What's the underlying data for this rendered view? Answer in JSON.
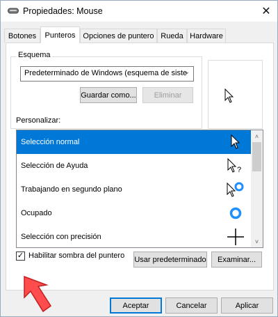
{
  "window": {
    "title": "Propiedades: Mouse",
    "close_label": "✕"
  },
  "tabs": [
    {
      "label": "Botones",
      "active": false
    },
    {
      "label": "Punteros",
      "active": true
    },
    {
      "label": "Opciones de puntero",
      "active": false
    },
    {
      "label": "Rueda",
      "active": false
    },
    {
      "label": "Hardware",
      "active": false
    }
  ],
  "scheme": {
    "group_label": "Esquema",
    "selected_value": "Predeterminado de Windows (esquema de siste",
    "save_label": "Guardar como...",
    "delete_label": "Eliminar"
  },
  "customize": {
    "label": "Personalizar:",
    "items": [
      {
        "label": "Selección normal",
        "selected": true,
        "icon": "arrow-cursor-icon"
      },
      {
        "label": "Selección de Ayuda",
        "selected": false,
        "icon": "help-cursor-icon"
      },
      {
        "label": "Trabajando en segundo plano",
        "selected": false,
        "icon": "working-cursor-icon"
      },
      {
        "label": "Ocupado",
        "selected": false,
        "icon": "busy-cursor-icon"
      },
      {
        "label": "Selección con precisión",
        "selected": false,
        "icon": "crosshair-cursor-icon"
      }
    ]
  },
  "shadow": {
    "label": "Habilitar sombra del puntero",
    "checked": true,
    "check_glyph": "✓"
  },
  "buttons": {
    "use_default": "Usar predeterminado",
    "browse": "Examinar...",
    "accept": "Aceptar",
    "cancel": "Cancelar",
    "apply": "Aplicar"
  },
  "colors": {
    "selection": "#0078d7",
    "busy_ring": "#1e8fff",
    "annotation_arrow": "#ff4d4d"
  }
}
